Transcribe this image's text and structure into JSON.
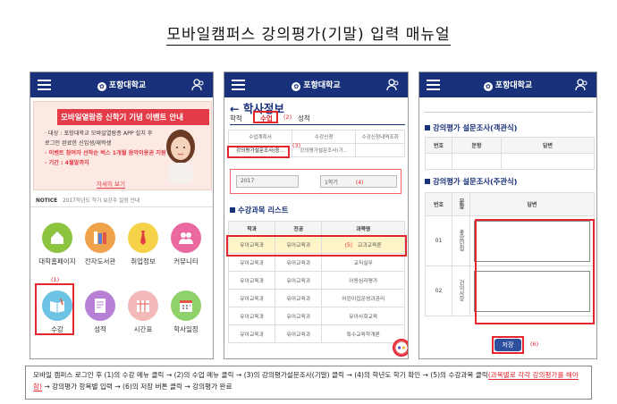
{
  "doc_title": "모바일캠퍼스 강의평가(기말) 입력 매뉴얼",
  "app": {
    "logo_text": "포항대학교"
  },
  "panel1": {
    "banner_title": "모바일열람증 신학기 기념 이벤트 안내",
    "banner_lines": [
      "· 대상 : 포항대학교 모바일열람증 APP 설치 후",
      "  로그인 완료한 신입생/재학생",
      "· 이벤트 참여자 선착순 벅스 1개월 음악이용권 지원",
      "· 기간 : 4월말까지"
    ],
    "banner_more": "자세히 보기",
    "notice_label": "NOTICE",
    "notice_text": "2017학년도 학기 보강주 일정 안내",
    "tiles": [
      {
        "label": "대학홈페이지",
        "icon": "home-icon",
        "color": "#8cc43f"
      },
      {
        "label": "전자도서관",
        "icon": "books-icon",
        "color": "#f0a24a"
      },
      {
        "label": "취업정보",
        "icon": "tie-icon",
        "color": "#f5d247"
      },
      {
        "label": "커뮤니티",
        "icon": "community-icon",
        "color": "#ea6aa0"
      },
      {
        "label": "수강",
        "icon": "book-icon",
        "color": "#6cc3e3"
      },
      {
        "label": "성적",
        "icon": "report-icon",
        "color": "#b77fd6"
      },
      {
        "label": "시간표",
        "icon": "timetable-icon",
        "color": "#f3b8b8"
      },
      {
        "label": "학사일정",
        "icon": "calendar-icon",
        "color": "#8fd16a"
      }
    ],
    "marker1": "(1)"
  },
  "panel2": {
    "header": "학사정보",
    "tabs": [
      "학적",
      "수업",
      "성적"
    ],
    "marker2": "(2)",
    "sub_menu": [
      "수업계획서",
      "수강신청",
      "수강신청내역조회",
      "강의평가설문조사(중...",
      "강의평가설문조사(기...",
      ""
    ],
    "marker3": "(3)",
    "year": "2017",
    "term": "1학기",
    "marker4": "(4)",
    "list_title": "수강과목 리스트",
    "list_headers": [
      "학과",
      "전공",
      "과목명"
    ],
    "list_rows": [
      [
        "유아교육과",
        "유아교육과",
        "교과교육론"
      ],
      [
        "유아교육과",
        "유아교육과",
        "교직실무"
      ],
      [
        "유아교육과",
        "유아교육과",
        "아동심리평가"
      ],
      [
        "유아교육과",
        "유아교육과",
        "어린이집운영과관리"
      ],
      [
        "유아교육과",
        "유아교육과",
        "유아사회교육"
      ],
      [
        "유아교육과",
        "유아교육과",
        "특수교육학개론"
      ]
    ],
    "marker5": "(5)"
  },
  "panel3": {
    "obj_title": "강의평가 설문조사(객관식)",
    "obj_headers": [
      "번호",
      "문항",
      "답변"
    ],
    "subj_title": "강의평가 설문조사(주관식)",
    "subj_headers": [
      "번호",
      "문항",
      "답변"
    ],
    "subj_rows": [
      {
        "no": "01",
        "q": "좋았던점"
      },
      {
        "no": "02",
        "q": "건의사항"
      }
    ],
    "save_label": "저장",
    "marker6": "(6)"
  },
  "instructions": {
    "part1": "모바일 캠퍼스 로그인 후 (1)의 수강 메뉴 클릭 → (2)의 수업 메뉴 클릭 → (3)의 강의평가설문조사(기말) 클릭 → (4)의 학년도 학기 확인 → (5)의 수강과목 클릭",
    "part2": "(과목별로 각각 강의평가를 해야함)",
    "part3": " → 강의평가 항목별 입력 → (6)의 저장 버튼 클릭 → 강의평가 완료"
  }
}
